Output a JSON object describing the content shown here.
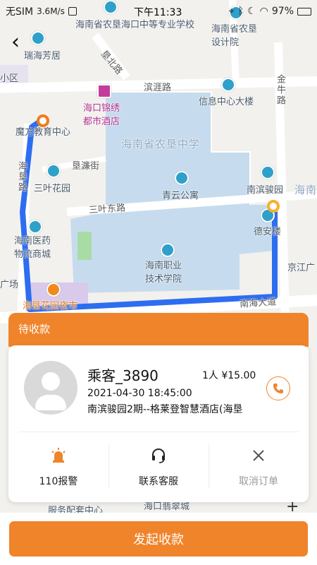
{
  "status_bar": {
    "carrier": "无SIM",
    "speed": "3.6M/s",
    "time": "下午11:33",
    "battery": "97%"
  },
  "map": {
    "labels": {
      "school_top": "海南省农垦海口中等专业学校",
      "design_institute": "海南省农垦设计院",
      "ruihai": "瑞海芳居",
      "xiaoqu": "小区",
      "kenbei_road": "垦北路",
      "binya_road": "滨涯路",
      "jinniu_road": "金牛路",
      "info_center": "信息中心大楼",
      "jinxiu_hotel": "海口锦绣都市酒店",
      "mofang": "魔方教育中心",
      "nongken_middle": "海南省农垦中学",
      "hainan_road_left": "海垦路",
      "kenlian_street": "垦濂街",
      "sanye_garden": "三叶花园",
      "qingyun": "青云公寓",
      "nanbin_garden": "南滨骏园",
      "hainan_right": "海南",
      "sanye_east_road": "三叶东路",
      "dean_tower": "德安楼",
      "pharma_city": "海南医药物流商城",
      "vocational": "海南职业技术学院",
      "jingjiang": "京江广",
      "guangchang": "广场",
      "night_market": "海垦花园夜市",
      "nanhai_avenue": "南海大道",
      "service_center": "服务配套中心",
      "bottom_partial": "海口翡翠城"
    },
    "zoom_in": "+"
  },
  "back_button": "‹",
  "order_card": {
    "status": "待收款",
    "passenger_name": "乘客_3890",
    "count_fare": "1人  ¥15.00",
    "time": "2021-04-30 18:45:00",
    "address": "南滨骏园2期--格莱登智慧酒店(海垦",
    "actions": [
      {
        "label": "110报警",
        "icon": "alarm-light-icon"
      },
      {
        "label": "联系客服",
        "icon": "headset-icon"
      },
      {
        "label": "取消订单",
        "icon": "close-icon"
      }
    ]
  },
  "primary_button": "发起收款",
  "colors": {
    "accent": "#f0842b",
    "route": "#2d6df0",
    "campus": "#c6dcee"
  }
}
